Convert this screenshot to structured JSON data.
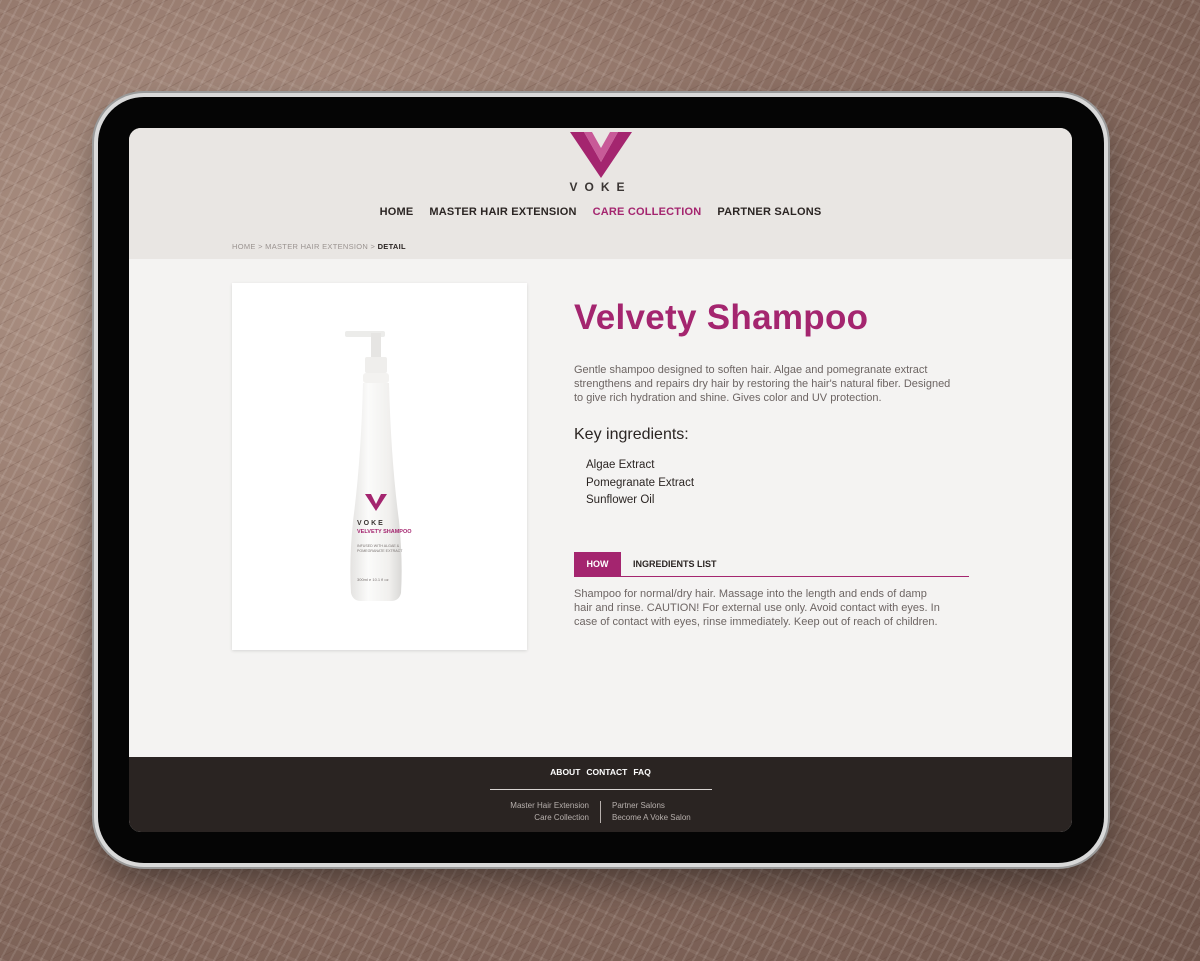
{
  "brand": {
    "name": "VOKE",
    "accent_color": "#a4256f"
  },
  "nav": {
    "items": [
      {
        "label": "HOME",
        "active": false
      },
      {
        "label": "MASTER HAIR EXTENSION",
        "active": false
      },
      {
        "label": "CARE COLLECTION",
        "active": true
      },
      {
        "label": "PARTNER SALONS",
        "active": false
      }
    ]
  },
  "breadcrumb": {
    "home": "HOME",
    "sep1": " > ",
    "section": "MASTER HAIR EXTENSION",
    "sep2": " > ",
    "current": "DETAIL"
  },
  "product": {
    "title": "Velvety Shampoo",
    "description": "Gentle shampoo designed to soften hair. Algae and pomegranate extract strengthens and repairs dry hair by restoring the hair's natural fiber. Designed to give rich hydration and shine. Gives color and UV protection.",
    "key_ingredients_title": "Key ingredients:",
    "key_ingredients": [
      "Algae Extract",
      "Pomegranate Extract",
      "Sunflower Oil"
    ],
    "tabs": [
      {
        "label": "HOW",
        "active": true
      },
      {
        "label": "INGREDIENTS LIST",
        "active": false
      }
    ],
    "how_text": "Shampoo for normal/dry hair. Massage into the length and ends of damp hair and rinse. CAUTION! For external use only. Avoid contact with eyes. In case of contact with eyes, rinse immediately. Keep out of reach of children.",
    "bottle_label": {
      "brand": "VOKE",
      "name": "VELVETY SHAMPOO",
      "line1": "INFUSED WITH ALGAE &",
      "line2": "POMEGRANATE EXTRACT",
      "volume": "300ml e 10.1 fl oz"
    }
  },
  "footer": {
    "links": [
      "ABOUT",
      "CONTACT",
      "FAQ"
    ],
    "left_col": [
      "Master Hair Extension",
      "Care Collection"
    ],
    "right_col": [
      "Partner Salons",
      "Become A Voke Salon"
    ]
  }
}
